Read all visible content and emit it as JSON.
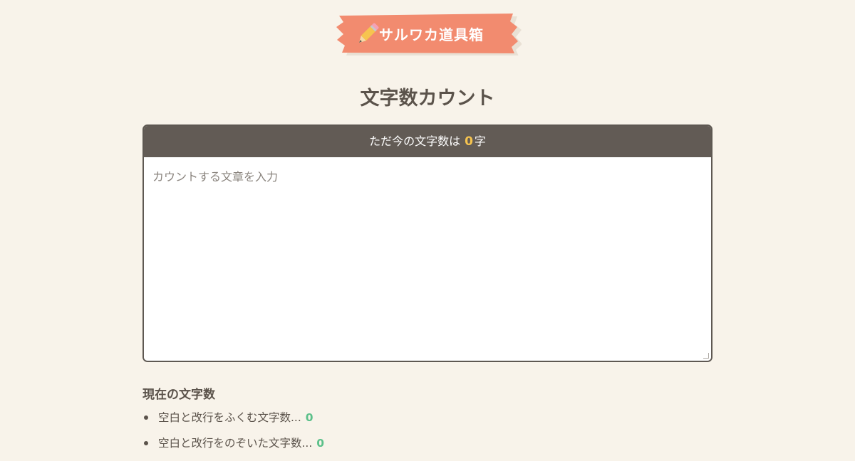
{
  "logo": {
    "text": "サルワカ道具箱",
    "icon": "pencil-icon",
    "banner_color": "#f28b6f"
  },
  "page": {
    "title": "文字数カウント"
  },
  "counter": {
    "prefix": "ただ今の文字数は",
    "value": "0",
    "suffix": "字",
    "placeholder": "カウントする文章を入力",
    "value_color": "#f6c44f"
  },
  "stats": {
    "heading": "現在の文字数",
    "items": [
      {
        "label": "空白と改行をふくむ文字数...",
        "value": "0"
      },
      {
        "label": "空白と改行をのぞいた文字数...",
        "value": "0"
      }
    ],
    "value_color": "#5cc08a"
  }
}
